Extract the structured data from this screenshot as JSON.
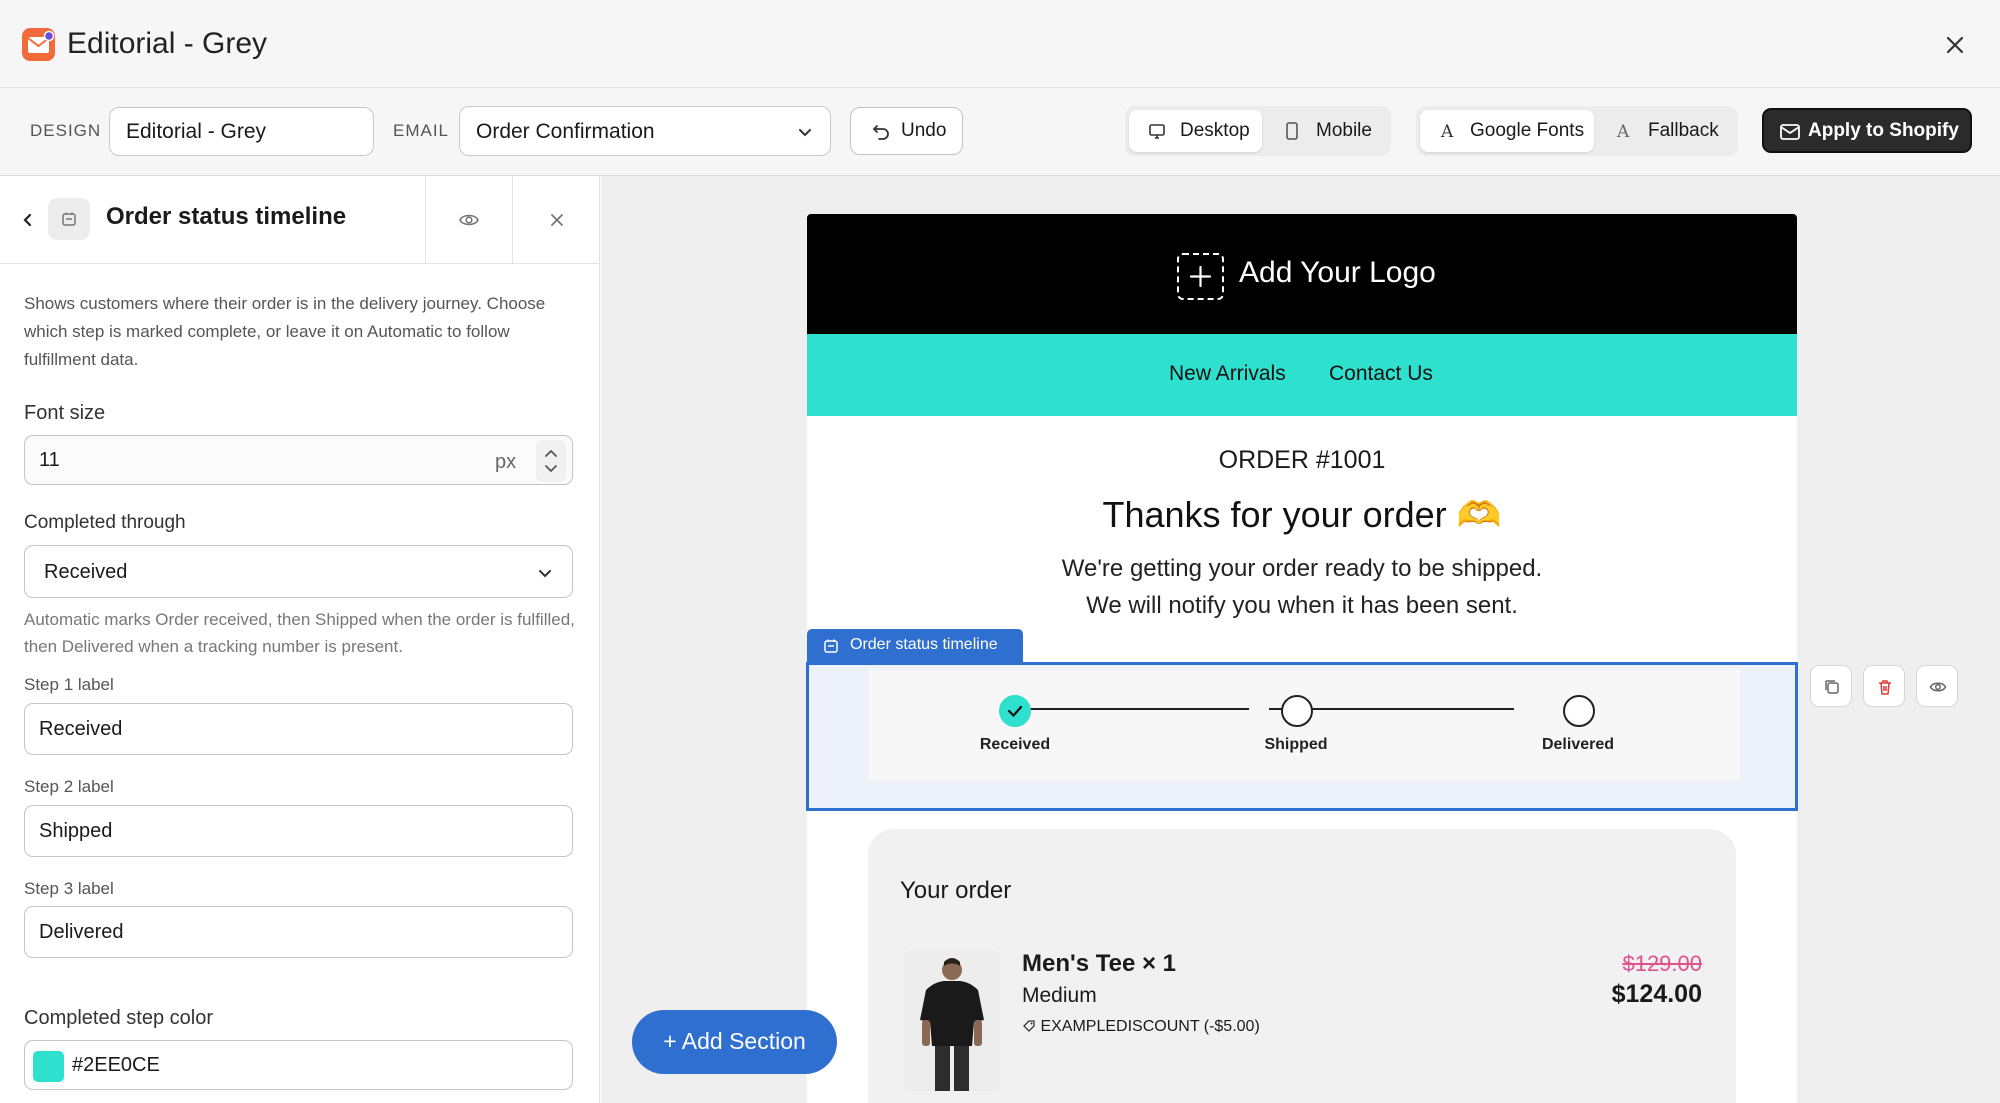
{
  "window": {
    "title": "Editorial - Grey"
  },
  "toolbar": {
    "design_label": "DESIGN",
    "design_value": "Editorial - Grey",
    "email_label": "EMAIL",
    "email_value": "Order Confirmation",
    "undo_label": "Undo",
    "view_desktop": "Desktop",
    "view_mobile": "Mobile",
    "font_google": "Google Fonts",
    "font_fallback": "Fallback",
    "apply_label": "Apply to Shopify"
  },
  "panel": {
    "title": "Order status timeline",
    "description": "Shows customers where their order is in the delivery journey. Choose which step is marked complete, or leave it on Automatic to follow fulfillment data.",
    "font_size_label": "Font size",
    "font_size_value": "11",
    "font_size_unit": "px",
    "completed_through_label": "Completed through",
    "completed_through_value": "Received",
    "hint": "Automatic marks Order received, then Shipped when the order is fulfilled, then Delivered when a tracking number is present.",
    "step1_label": "Step 1 label",
    "step1_value": "Received",
    "step2_label": "Step 2 label",
    "step2_value": "Shipped",
    "step3_label": "Step 3 label",
    "step3_value": "Delivered",
    "color_label": "Completed step color",
    "color_value": "#2EE0CE"
  },
  "email": {
    "logo_text": "Add Your Logo",
    "nav": [
      "New Arrivals",
      "Contact Us"
    ],
    "order_number": "ORDER #1001",
    "thanks": "Thanks for your order 🫶",
    "subtitle_1": "We're getting your order ready to be shipped.",
    "subtitle_2": "We will notify you when it has been sent.",
    "timeline_tag": "Order status timeline",
    "timeline_steps": [
      "Received",
      "Shipped",
      "Delivered"
    ],
    "order_heading": "Your order",
    "product": {
      "name": "Men's Tee × 1",
      "variant": "Medium",
      "discount": "EXAMPLEDISCOUNT (-$5.00)",
      "old_price": "$129.00",
      "price": "$124.00"
    }
  },
  "add_section_label": "+ Add Section",
  "colors": {
    "accent": "#2F6FD0",
    "completed_step": "#2EE0CE",
    "nav_bar": "#2EE0CE",
    "strike_price": "#E0528B"
  }
}
